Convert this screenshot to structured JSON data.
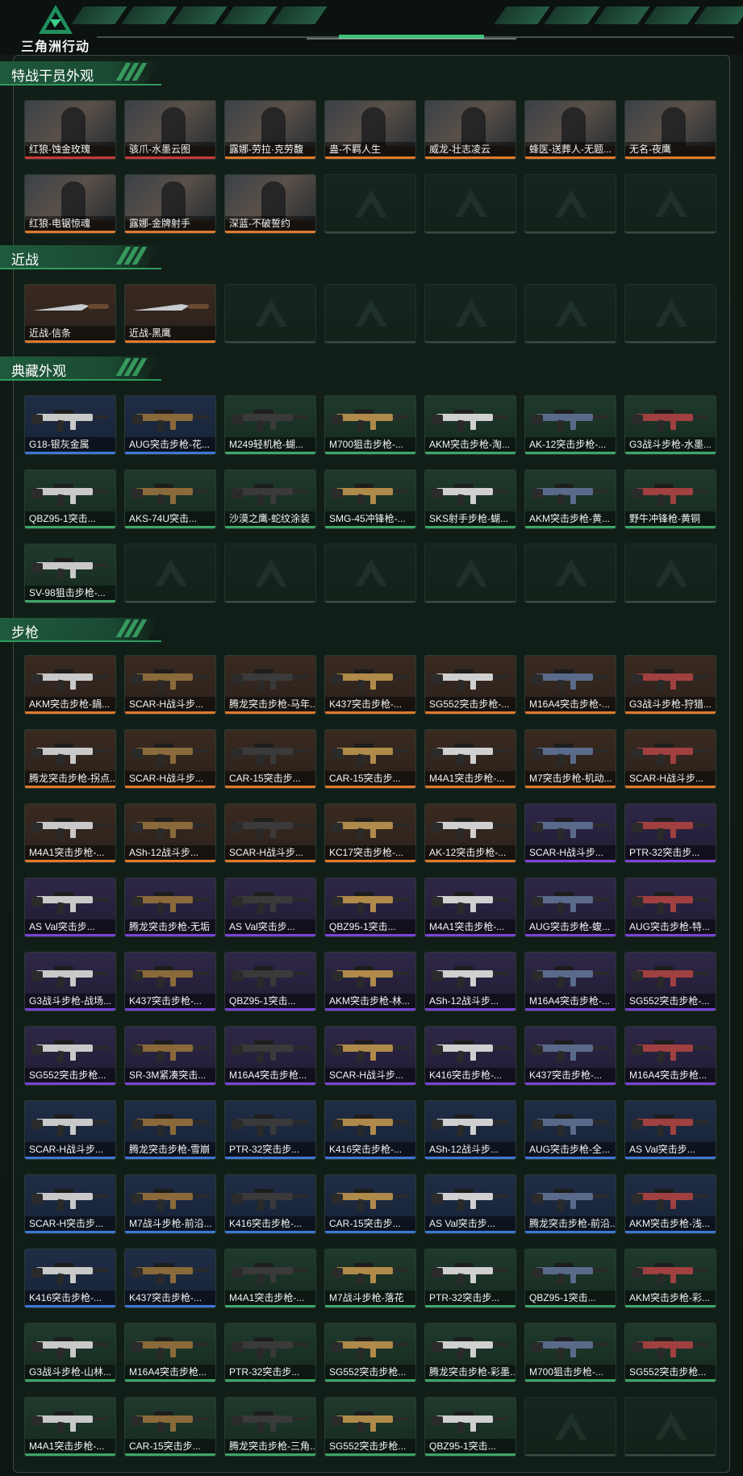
{
  "header": {
    "title": "三角洲行动"
  },
  "sections": [
    {
      "title": "特战干员外观",
      "type": "operator",
      "empty_slots": 4,
      "items": [
        {
          "label": "红狼-蚀金玫瑰",
          "rarity": "red"
        },
        {
          "label": "骇爪-水墨云图",
          "rarity": "red"
        },
        {
          "label": "露娜-劳拉·克劳馥",
          "rarity": "orange"
        },
        {
          "label": "蛊-不羁人生",
          "rarity": "orange"
        },
        {
          "label": "威龙-壮志凌云",
          "rarity": "orange"
        },
        {
          "label": "蜂医-送葬人-无题...",
          "rarity": "orange"
        },
        {
          "label": "无名-夜鹰",
          "rarity": "orange"
        },
        {
          "label": "红狼-电锯惊魂",
          "rarity": "orange"
        },
        {
          "label": "露娜-金牌射手",
          "rarity": "orange"
        },
        {
          "label": "深蓝-不破誓约",
          "rarity": "orange"
        }
      ]
    },
    {
      "title": "近战",
      "type": "melee",
      "empty_slots": 5,
      "items": [
        {
          "label": "近战-信条",
          "rarity": "orange"
        },
        {
          "label": "近战-黑鹰",
          "rarity": "orange"
        }
      ]
    },
    {
      "title": "典藏外观",
      "type": "gun",
      "empty_slots": 6,
      "items": [
        {
          "label": "G18-银灰金属",
          "rarity": "blue"
        },
        {
          "label": "AUG突击步枪-花...",
          "rarity": "blue"
        },
        {
          "label": "M249轻机枪-蝴...",
          "rarity": "green"
        },
        {
          "label": "M700狙击步枪-...",
          "rarity": "green"
        },
        {
          "label": "AKM突击步枪-淘...",
          "rarity": "green"
        },
        {
          "label": "AK-12突击步枪-...",
          "rarity": "green"
        },
        {
          "label": "G3战斗步枪-水墨...",
          "rarity": "green"
        },
        {
          "label": "QBZ95-1突击...",
          "rarity": "green"
        },
        {
          "label": "AKS-74U突击...",
          "rarity": "green"
        },
        {
          "label": "沙漠之鹰-蛇纹涂装",
          "rarity": "green"
        },
        {
          "label": "SMG-45冲锋枪-...",
          "rarity": "green"
        },
        {
          "label": "SKS射手步枪-蝴...",
          "rarity": "green"
        },
        {
          "label": "AKM突击步枪-黄...",
          "rarity": "green"
        },
        {
          "label": "野牛冲锋枪-黄铜",
          "rarity": "green"
        },
        {
          "label": "SV-98狙击步枪-...",
          "rarity": "green"
        }
      ]
    },
    {
      "title": "步枪",
      "type": "gun",
      "empty_slots": 2,
      "items": [
        {
          "label": "AKM突击步枪-鍋...",
          "rarity": "orange"
        },
        {
          "label": "SCAR-H战斗步...",
          "rarity": "orange"
        },
        {
          "label": "腾龙突击步枪-马年...",
          "rarity": "orange"
        },
        {
          "label": "K437突击步枪-...",
          "rarity": "orange"
        },
        {
          "label": "SG552突击步枪-...",
          "rarity": "orange"
        },
        {
          "label": "M16A4突击步枪-...",
          "rarity": "orange"
        },
        {
          "label": "G3战斗步枪-狩猎...",
          "rarity": "orange"
        },
        {
          "label": "腾龙突击步枪-拐点...",
          "rarity": "orange"
        },
        {
          "label": "SCAR-H战斗步...",
          "rarity": "orange"
        },
        {
          "label": "CAR-15突击步...",
          "rarity": "orange"
        },
        {
          "label": "CAR-15突击步...",
          "rarity": "orange"
        },
        {
          "label": "M4A1突击步枪-...",
          "rarity": "orange"
        },
        {
          "label": "M7突击步枪-机动...",
          "rarity": "orange"
        },
        {
          "label": "SCAR-H战斗步...",
          "rarity": "orange"
        },
        {
          "label": "M4A1突击步枪-...",
          "rarity": "orange"
        },
        {
          "label": "ASh-12战斗步...",
          "rarity": "orange"
        },
        {
          "label": "SCAR-H战斗步...",
          "rarity": "orange"
        },
        {
          "label": "KC17突击步枪-...",
          "rarity": "orange"
        },
        {
          "label": "AK-12突击步枪-...",
          "rarity": "orange"
        },
        {
          "label": "SCAR-H战斗步...",
          "rarity": "purple"
        },
        {
          "label": "PTR-32突击步...",
          "rarity": "purple"
        },
        {
          "label": "AS Val突击步...",
          "rarity": "purple"
        },
        {
          "label": "腾龙突击步枪-无垢",
          "rarity": "purple"
        },
        {
          "label": "AS Val突击步...",
          "rarity": "purple"
        },
        {
          "label": "QBZ95-1突击...",
          "rarity": "purple"
        },
        {
          "label": "M4A1突击步枪-...",
          "rarity": "purple"
        },
        {
          "label": "AUG突击步枪-蝮...",
          "rarity": "purple"
        },
        {
          "label": "AUG突击步枪-特...",
          "rarity": "purple"
        },
        {
          "label": "G3战斗步枪-战场...",
          "rarity": "purple"
        },
        {
          "label": "K437突击步枪-...",
          "rarity": "purple"
        },
        {
          "label": "QBZ95-1突击...",
          "rarity": "purple"
        },
        {
          "label": "AKM突击步枪-林...",
          "rarity": "purple"
        },
        {
          "label": "ASh-12战斗步...",
          "rarity": "purple"
        },
        {
          "label": "M16A4突击步枪-...",
          "rarity": "purple"
        },
        {
          "label": "SG552突击步枪-...",
          "rarity": "purple"
        },
        {
          "label": "SG552突击步枪...",
          "rarity": "purple"
        },
        {
          "label": "SR-3M紧凑突击...",
          "rarity": "purple"
        },
        {
          "label": "M16A4突击步枪...",
          "rarity": "purple"
        },
        {
          "label": "SCAR-H战斗步...",
          "rarity": "purple"
        },
        {
          "label": "K416突击步枪-...",
          "rarity": "purple"
        },
        {
          "label": "K437突击步枪-...",
          "rarity": "purple"
        },
        {
          "label": "M16A4突击步枪...",
          "rarity": "purple"
        },
        {
          "label": "SCAR-H战斗步...",
          "rarity": "blue"
        },
        {
          "label": "腾龙突击步枪-雪崩",
          "rarity": "blue"
        },
        {
          "label": "PTR-32突击步...",
          "rarity": "blue"
        },
        {
          "label": "K416突击步枪-...",
          "rarity": "blue"
        },
        {
          "label": "ASh-12战斗步...",
          "rarity": "blue"
        },
        {
          "label": "AUG突击步枪-全...",
          "rarity": "blue"
        },
        {
          "label": "AS Val突击步...",
          "rarity": "blue"
        },
        {
          "label": "SCAR-H突击步...",
          "rarity": "blue"
        },
        {
          "label": "M7战斗步枪-前沿...",
          "rarity": "blue"
        },
        {
          "label": "K416突击步枪-...",
          "rarity": "blue"
        },
        {
          "label": "CAR-15突击步...",
          "rarity": "blue"
        },
        {
          "label": "AS Val突击步...",
          "rarity": "blue"
        },
        {
          "label": "腾龙突击步枪-前沿...",
          "rarity": "blue"
        },
        {
          "label": "AKM突击步枪-浅...",
          "rarity": "blue"
        },
        {
          "label": "K416突击步枪-...",
          "rarity": "blue"
        },
        {
          "label": "K437突击步枪-...",
          "rarity": "blue"
        },
        {
          "label": "M4A1突击步枪-...",
          "rarity": "green"
        },
        {
          "label": "M7战斗步枪-落花",
          "rarity": "green"
        },
        {
          "label": "PTR-32突击步...",
          "rarity": "green"
        },
        {
          "label": "QBZ95-1突击...",
          "rarity": "green"
        },
        {
          "label": "AKM突击步枪-彩...",
          "rarity": "green"
        },
        {
          "label": "G3战斗步枪-山林...",
          "rarity": "green"
        },
        {
          "label": "M16A4突击步枪...",
          "rarity": "green"
        },
        {
          "label": "PTR-32突击步...",
          "rarity": "green"
        },
        {
          "label": "SG552突击步枪...",
          "rarity": "green"
        },
        {
          "label": "腾龙突击步枪-彩墨...",
          "rarity": "green"
        },
        {
          "label": "M700狙击步枪-...",
          "rarity": "green"
        },
        {
          "label": "SG552突击步枪...",
          "rarity": "green"
        },
        {
          "label": "M4A1突击步枪-...",
          "rarity": "green"
        },
        {
          "label": "CAR-15突击步...",
          "rarity": "green"
        },
        {
          "label": "腾龙突击步枪-三角...",
          "rarity": "green"
        },
        {
          "label": "SG552突击步枪...",
          "rarity": "green"
        },
        {
          "label": "QBZ95-1突击...",
          "rarity": "green"
        }
      ]
    }
  ],
  "colors": {
    "accent": "#3ea56a",
    "orange": "#e0792a",
    "green": "#3ea56a",
    "purple": "#7a44d8",
    "blue": "#3d77d6",
    "red": "#c73a37"
  }
}
